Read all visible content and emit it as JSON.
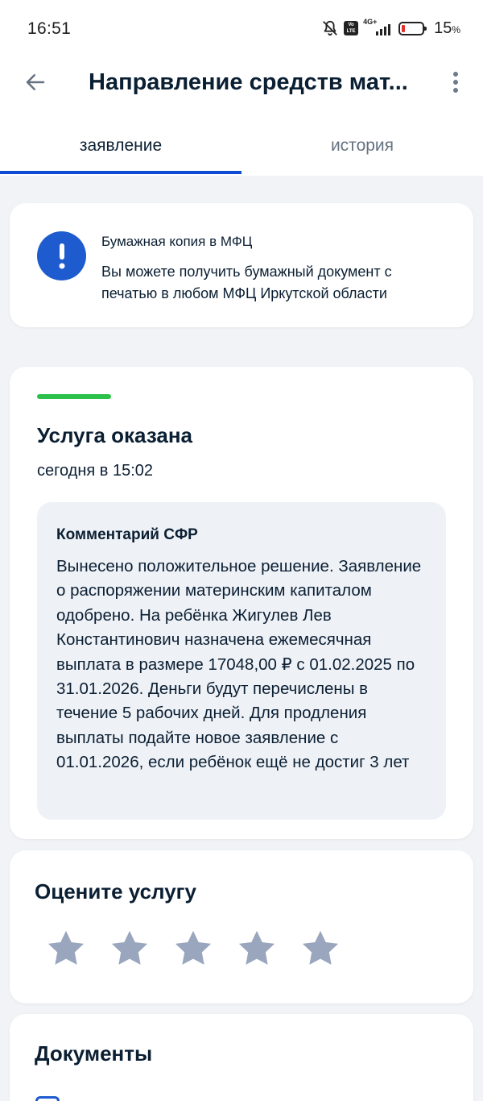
{
  "status_bar": {
    "time": "16:51",
    "network": "4G+",
    "volte": "Vo LTE",
    "battery_percent": "15",
    "battery_suffix": "%",
    "battery_level": 0.15
  },
  "app_bar": {
    "title": "Направление средств мат..."
  },
  "tabs": [
    {
      "label": "заявление",
      "active": true
    },
    {
      "label": "история",
      "active": false
    }
  ],
  "info_card": {
    "title": "Бумажная копия в МФЦ",
    "text": "Вы можете получить бумажный документ с печатью в любом МФЦ Иркутской области"
  },
  "status_card": {
    "status": "Услуга оказана",
    "date": "сегодня в 15:02",
    "comment_title": "Комментарий СФР",
    "comment_text": "Вынесено положительное решение. Заявление о распоряжении материнским капиталом одобрено. На ребёнка Жигулев Лев Константинович назначена ежемесячная выплата в размере 17048,00 ₽ с 01.02.2025 по 31.01.2026. Деньги будут перечислены в течение 5 рабочих дней. Для продления выплаты подайте новое заявление с 01.01.2026, если ребёнок ещё не достиг 3 лет"
  },
  "rate_card": {
    "title": "Оцените услугу",
    "stars_total": 5,
    "stars_selected": 0
  },
  "documents_card": {
    "title": "Документы"
  },
  "colors": {
    "accent": "#0d4cd3",
    "info_icon": "#1e5bce",
    "success": "#2cc14a",
    "star": "#9aa6bd",
    "comment_bg": "#eef1f6",
    "page_bg": "#f1f3f6"
  },
  "icons": {
    "back": "arrow-left-icon",
    "more": "more-vertical-icon",
    "info": "exclamation-icon",
    "star": "star-icon",
    "mute": "bell-off-icon",
    "document": "document-icon"
  }
}
